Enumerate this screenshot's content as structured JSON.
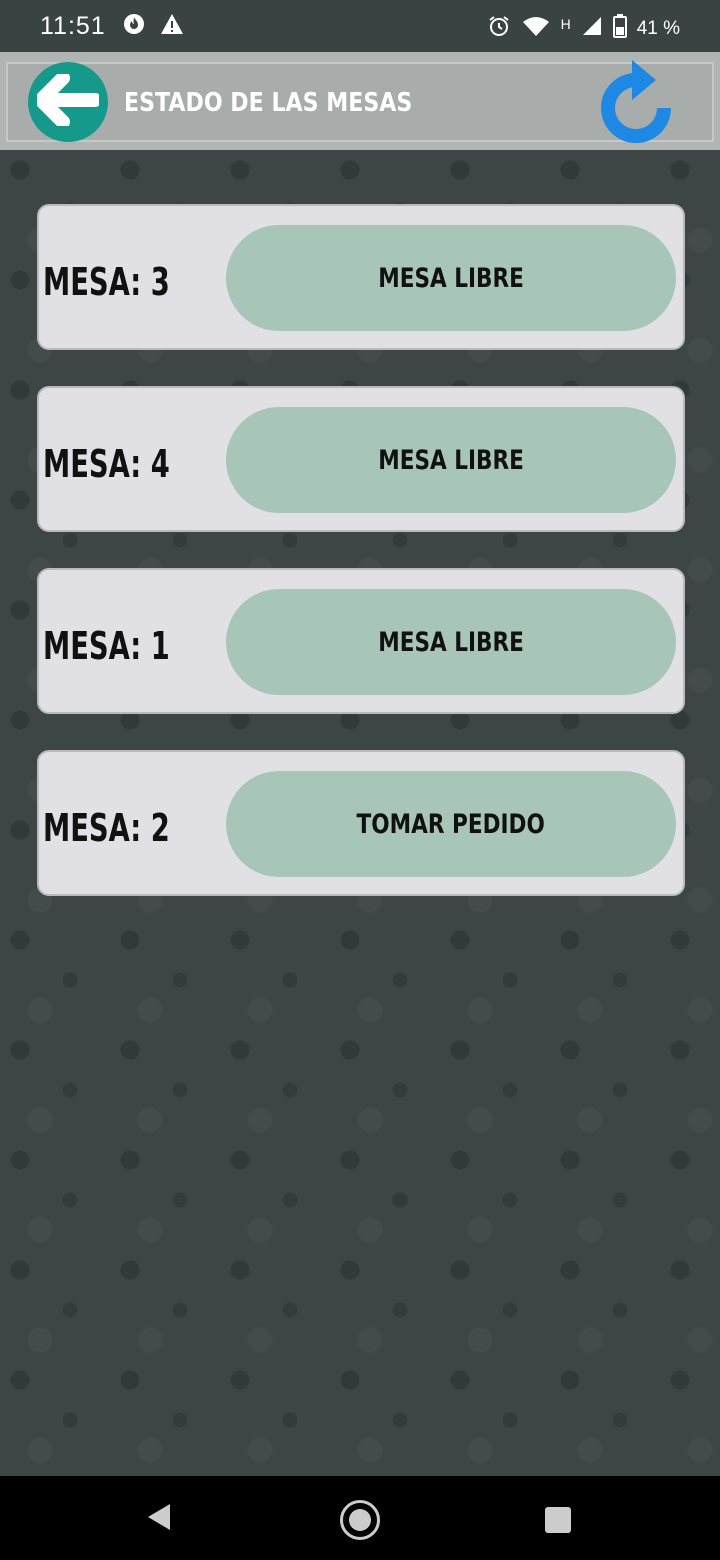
{
  "status_bar": {
    "time": "11:51",
    "network_type": "H",
    "battery": "41 %",
    "icons_left": [
      "fire-icon",
      "warning-icon"
    ],
    "icons_right": [
      "alarm-icon",
      "wifi-icon",
      "signal-icon",
      "battery-icon"
    ]
  },
  "header": {
    "title": "ESTADO DE LAS MESAS",
    "back_icon": "arrow-left-icon",
    "refresh_icon": "refresh-icon",
    "accent_color": "#14998a",
    "refresh_color": "#1e88e5"
  },
  "tables": [
    {
      "label": "MESA: 3",
      "status": "MESA LIBRE"
    },
    {
      "label": "MESA: 4",
      "status": "MESA LIBRE"
    },
    {
      "label": "MESA: 1",
      "status": "MESA LIBRE"
    },
    {
      "label": "MESA: 2",
      "status": "TOMAR PEDIDO"
    }
  ],
  "colors": {
    "background": "#3d4545",
    "card": "#e0e0e5",
    "pill": "#a8c6b7"
  },
  "nav_bar": {
    "icons": [
      "nav-back-icon",
      "nav-home-icon",
      "nav-recent-icon"
    ]
  }
}
